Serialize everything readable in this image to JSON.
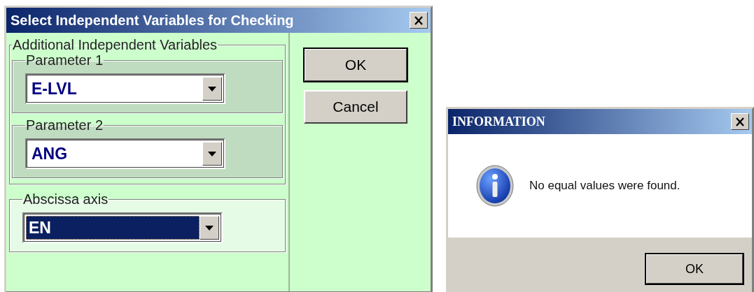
{
  "main_dialog": {
    "title": "Select Independent Variables for Checking",
    "group": {
      "label": "Additional Independent Variables",
      "parameters": [
        {
          "label": "Parameter 1",
          "value": "E-LVL",
          "focused": false
        },
        {
          "label": "Parameter 2",
          "value": "ANG",
          "focused": false
        }
      ]
    },
    "abscissa": {
      "label": "Abscissa axis",
      "value": "EN",
      "focused": true
    },
    "buttons": [
      {
        "label": "OK",
        "default": true
      },
      {
        "label": "Cancel",
        "default": false
      }
    ]
  },
  "message_box": {
    "title": "INFORMATION",
    "message": "No equal values were found.",
    "buttons": [
      {
        "label": "OK",
        "default": true
      }
    ]
  }
}
